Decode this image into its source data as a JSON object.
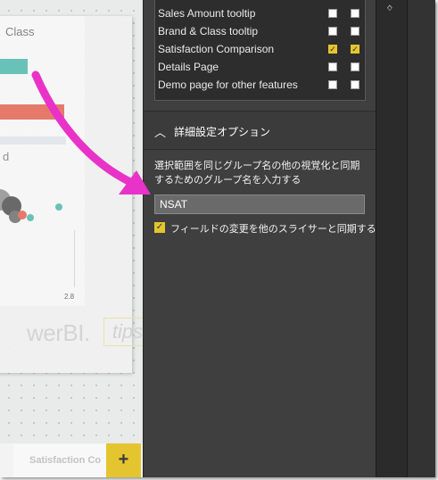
{
  "canvas": {
    "card_title": "Class",
    "card_letter": "d",
    "axis_tick": "2.8",
    "watermark_text": "werBI.",
    "watermark_tips": "tips"
  },
  "tabs": {
    "page_tab_label": "Satisfaction Co",
    "add_page_label": "+"
  },
  "sync_table": {
    "rows": [
      {
        "label": "Sales Amount tooltip",
        "sync": false,
        "visible": false
      },
      {
        "label": "Brand & Class tooltip",
        "sync": false,
        "visible": false
      },
      {
        "label": "Satisfaction Comparison",
        "sync": true,
        "visible": true
      },
      {
        "label": "Details Page",
        "sync": false,
        "visible": false
      },
      {
        "label": "Demo page for other features",
        "sync": false,
        "visible": false
      }
    ]
  },
  "advanced": {
    "title": "詳細設定オプション",
    "description": "選択範囲を同じグループ名の他の視覚化と同期するためのグループ名を入力する",
    "group_name_value": "NSAT",
    "sync_field_label": "フィールドの変更を他のスライサーと同期する",
    "sync_field_checked": true
  },
  "colors": {
    "accent": "#e4c52f",
    "arrow": "#e832c8",
    "panel_bg": "#3f3f3f",
    "bar_teal": "#5fbfb4",
    "bar_red": "#e57161"
  },
  "icons": {
    "collapse": "chevron-up-icon",
    "add_page": "plus-icon",
    "strip": "eye-icon"
  }
}
